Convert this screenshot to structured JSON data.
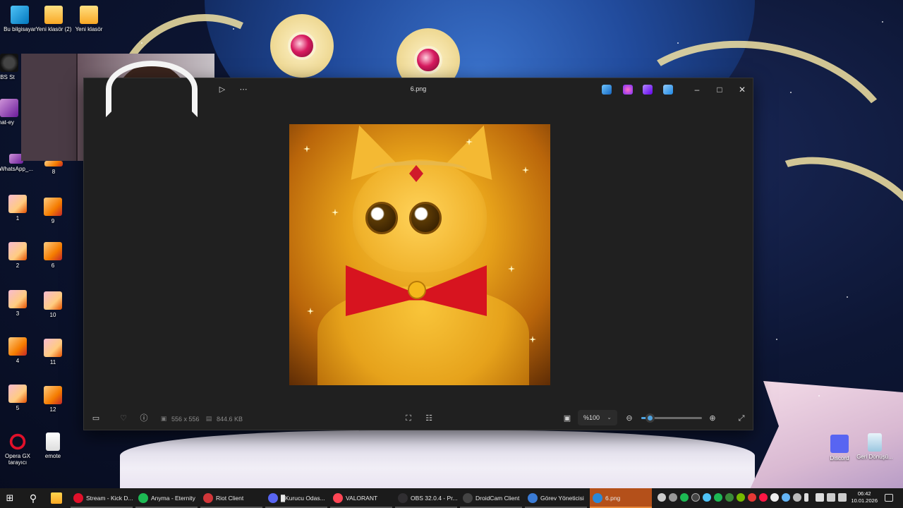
{
  "desktop": {
    "icons": [
      {
        "name": "this-pc",
        "label": "Bu bilgisayar",
        "kind": "pc"
      },
      {
        "name": "new-folder-2",
        "label": "Yeni klasör (2)",
        "kind": "folder"
      },
      {
        "name": "new-folder",
        "label": "Yeni klasör",
        "kind": "folder"
      },
      {
        "name": "obs",
        "label": "OBS St",
        "kind": "obs"
      },
      {
        "name": "what-eye",
        "label": "what-ey",
        "kind": "app"
      },
      {
        "name": "whatsapp",
        "label": "WhatsApp_...",
        "kind": "app"
      },
      {
        "name": "img-8",
        "label": "8",
        "kind": "img"
      },
      {
        "name": "img-1",
        "label": "1",
        "kind": "img2"
      },
      {
        "name": "img-9",
        "label": "9",
        "kind": "img"
      },
      {
        "name": "img-2",
        "label": "2",
        "kind": "img2"
      },
      {
        "name": "img-6",
        "label": "6",
        "kind": "img"
      },
      {
        "name": "img-3",
        "label": "3",
        "kind": "img2"
      },
      {
        "name": "img-10",
        "label": "10",
        "kind": "img2"
      },
      {
        "name": "img-4",
        "label": "4",
        "kind": "img"
      },
      {
        "name": "img-11",
        "label": "11",
        "kind": "img2"
      },
      {
        "name": "img-5",
        "label": "5",
        "kind": "img2"
      },
      {
        "name": "img-12",
        "label": "12",
        "kind": "img"
      },
      {
        "name": "opera-gx",
        "label": "Opera GX tarayıcı",
        "kind": "opera"
      },
      {
        "name": "emote",
        "label": "emote",
        "kind": "doc"
      },
      {
        "name": "discord",
        "label": "Discord",
        "kind": "discord"
      },
      {
        "name": "recycle-bin",
        "label": "Geri Dönüşü...",
        "kind": "bin"
      }
    ]
  },
  "photos_window": {
    "title": "6.png",
    "dimensions": "556 x 556",
    "file_size": "844.6 KB",
    "zoom": "%100",
    "zoom_level": 0.14
  },
  "taskbar": {
    "tasks": [
      {
        "label": "Stream - Kick D...",
        "color": "#e0102a"
      },
      {
        "label": "Anyma - Eternity",
        "color": "#1db954"
      },
      {
        "label": "Riot Client",
        "color": "#d13639"
      },
      {
        "label": "█Kurucu Odas...",
        "color": "#5865f2"
      },
      {
        "label": "VALORANT",
        "color": "#ff4655"
      },
      {
        "label": "OBS 32.0.4 - Pr...",
        "color": "#302e31"
      },
      {
        "label": "DroidCam Client",
        "color": "#444444"
      },
      {
        "label": "Görev Yöneticisi",
        "color": "#3a7bd5"
      },
      {
        "label": "6.png",
        "color": "#2b88d8"
      }
    ],
    "time": "06:42",
    "date": "10.01.2026"
  }
}
